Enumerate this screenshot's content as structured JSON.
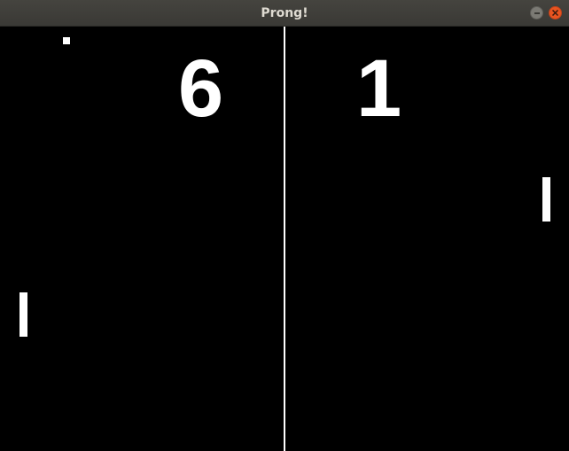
{
  "window": {
    "title": "Prong!",
    "controls": [
      "minimize-icon",
      "close-icon"
    ],
    "close_color": "#e95420"
  },
  "game": {
    "score_left": "6",
    "score_right": "1",
    "background_color": "#000000",
    "foreground_color": "#ffffff"
  }
}
